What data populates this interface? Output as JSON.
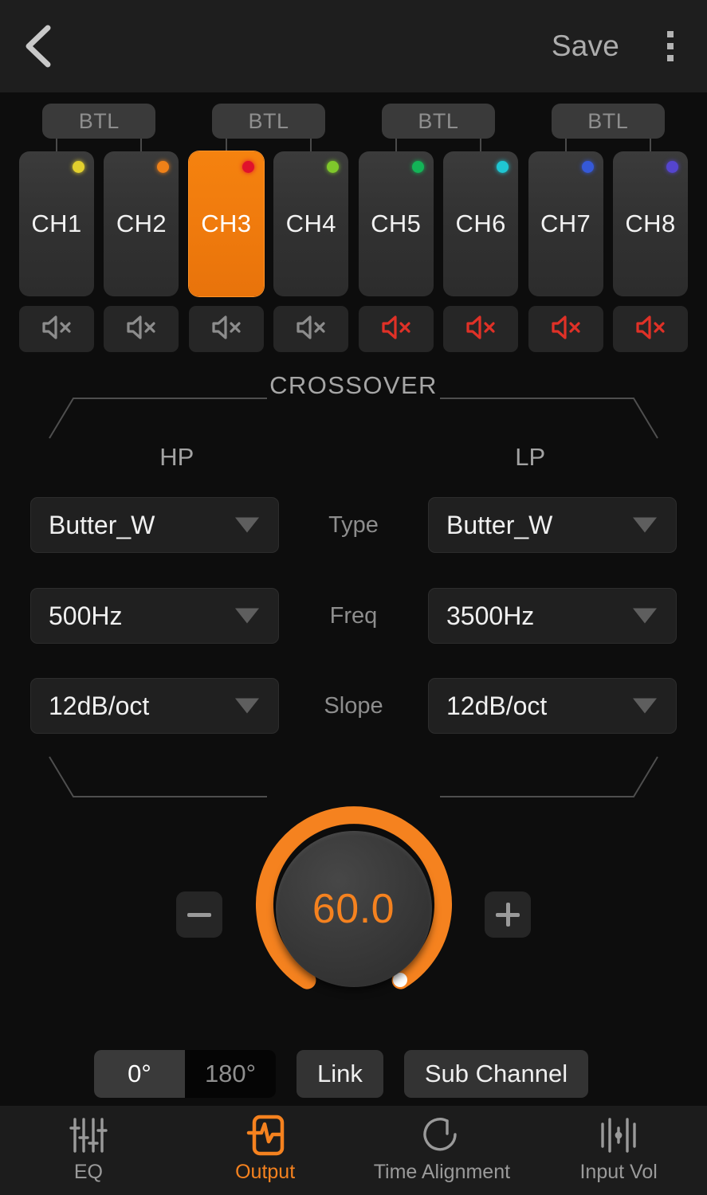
{
  "header": {
    "back_icon": "chevron-left-icon",
    "save_label": "Save",
    "menu_icon": "kebab-menu-icon"
  },
  "colors": {
    "accent": "#f5821f",
    "muted_red": "#e03127",
    "bg": "#0d0d0d",
    "panel": "#2f2f2f"
  },
  "channels": {
    "btl_label": "BTL",
    "btl_groups": [
      {
        "label": "BTL"
      },
      {
        "label": "BTL"
      },
      {
        "label": "BTL"
      },
      {
        "label": "BTL"
      }
    ],
    "items": [
      {
        "label": "CH1",
        "led": "#e2d02e",
        "selected": false,
        "muted": false,
        "mute_icon": "speaker-mute-icon"
      },
      {
        "label": "CH2",
        "led": "#ef8118",
        "selected": false,
        "muted": false,
        "mute_icon": "speaker-mute-icon"
      },
      {
        "label": "CH3",
        "led": "#e0122c",
        "selected": true,
        "muted": false,
        "mute_icon": "speaker-mute-icon"
      },
      {
        "label": "CH4",
        "led": "#7fc82b",
        "selected": false,
        "muted": false,
        "mute_icon": "speaker-mute-icon"
      },
      {
        "label": "CH5",
        "led": "#13b457",
        "selected": false,
        "muted": true,
        "mute_icon": "speaker-mute-icon"
      },
      {
        "label": "CH6",
        "led": "#1fc6d2",
        "selected": false,
        "muted": true,
        "mute_icon": "speaker-mute-icon"
      },
      {
        "label": "CH7",
        "led": "#3559d8",
        "selected": false,
        "muted": true,
        "mute_icon": "speaker-mute-icon"
      },
      {
        "label": "CH8",
        "led": "#5545cf",
        "selected": false,
        "muted": true,
        "mute_icon": "speaker-mute-icon"
      }
    ]
  },
  "crossover": {
    "title": "CROSSOVER",
    "hp_header": "HP",
    "lp_header": "LP",
    "rows": [
      {
        "label": "Type",
        "hp": "Butter_W",
        "lp": "Butter_W"
      },
      {
        "label": "Freq",
        "hp": "500Hz",
        "lp": "3500Hz"
      },
      {
        "label": "Slope",
        "hp": "12dB/oct",
        "lp": "12dB/oct"
      }
    ]
  },
  "gain": {
    "value": "60.0",
    "minus_label": "minus-icon",
    "plus_label": "plus-icon"
  },
  "controls": {
    "phase": {
      "options": [
        {
          "label": "0°",
          "selected": true
        },
        {
          "label": "180°",
          "selected": false
        }
      ]
    },
    "link_label": "Link",
    "sub_channel_label": "Sub Channel"
  },
  "tabbar": {
    "tabs": [
      {
        "label": "EQ",
        "icon": "sliders-icon",
        "active": false
      },
      {
        "label": "Output",
        "icon": "output-wave-icon",
        "active": true
      },
      {
        "label": "Time Alignment",
        "icon": "gauge-icon",
        "active": false
      },
      {
        "label": "Input Vol",
        "icon": "levels-icon",
        "active": false
      }
    ]
  }
}
